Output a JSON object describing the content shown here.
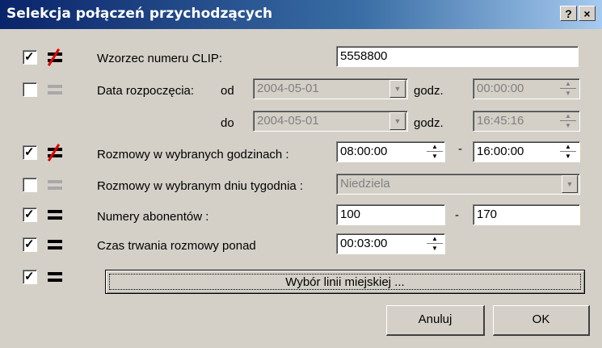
{
  "window": {
    "title": "Selekcja połączeń przychodzących",
    "help_label": "?",
    "close_label": "×"
  },
  "rows": {
    "clip": {
      "label": "Wzorzec numeru CLIP:",
      "value": "5558800",
      "checked": true,
      "icon": "not-equal-icon"
    },
    "date": {
      "label": "Data rozpoczęcia:",
      "from_label": "od",
      "to_label": "do",
      "time_label": "godz.",
      "from_date": "2004-05-01",
      "from_time": "00:00:00",
      "to_date": "2004-05-01",
      "to_time": "16:45:16",
      "checked": false,
      "icon": "equal-icon"
    },
    "hours": {
      "label": "Rozmowy w wybranych godzinach :",
      "from": "08:00:00",
      "separator": "-",
      "to": "16:00:00",
      "checked": true,
      "icon": "not-equal-icon"
    },
    "weekday": {
      "label": "Rozmowy w wybranym dniu tygodnia :",
      "value": "Niedziela",
      "checked": false,
      "icon": "equal-icon"
    },
    "subscribers": {
      "label": "Numery abonentów :",
      "from": "100",
      "separator": "-",
      "to": "170",
      "checked": true,
      "icon": "equal-icon"
    },
    "duration": {
      "label": "Czas trwania rozmowy ponad",
      "value": "00:03:00",
      "checked": true,
      "icon": "equal-icon"
    },
    "lines": {
      "button_label": "Wybór linii miejskiej ...",
      "checked": true,
      "icon": "equal-icon"
    }
  },
  "buttons": {
    "cancel": "Anuluj",
    "ok": "OK"
  },
  "check_glyph": "✓",
  "spin_up": "▲",
  "spin_down": "▼",
  "dropdown_glyph": "▼"
}
